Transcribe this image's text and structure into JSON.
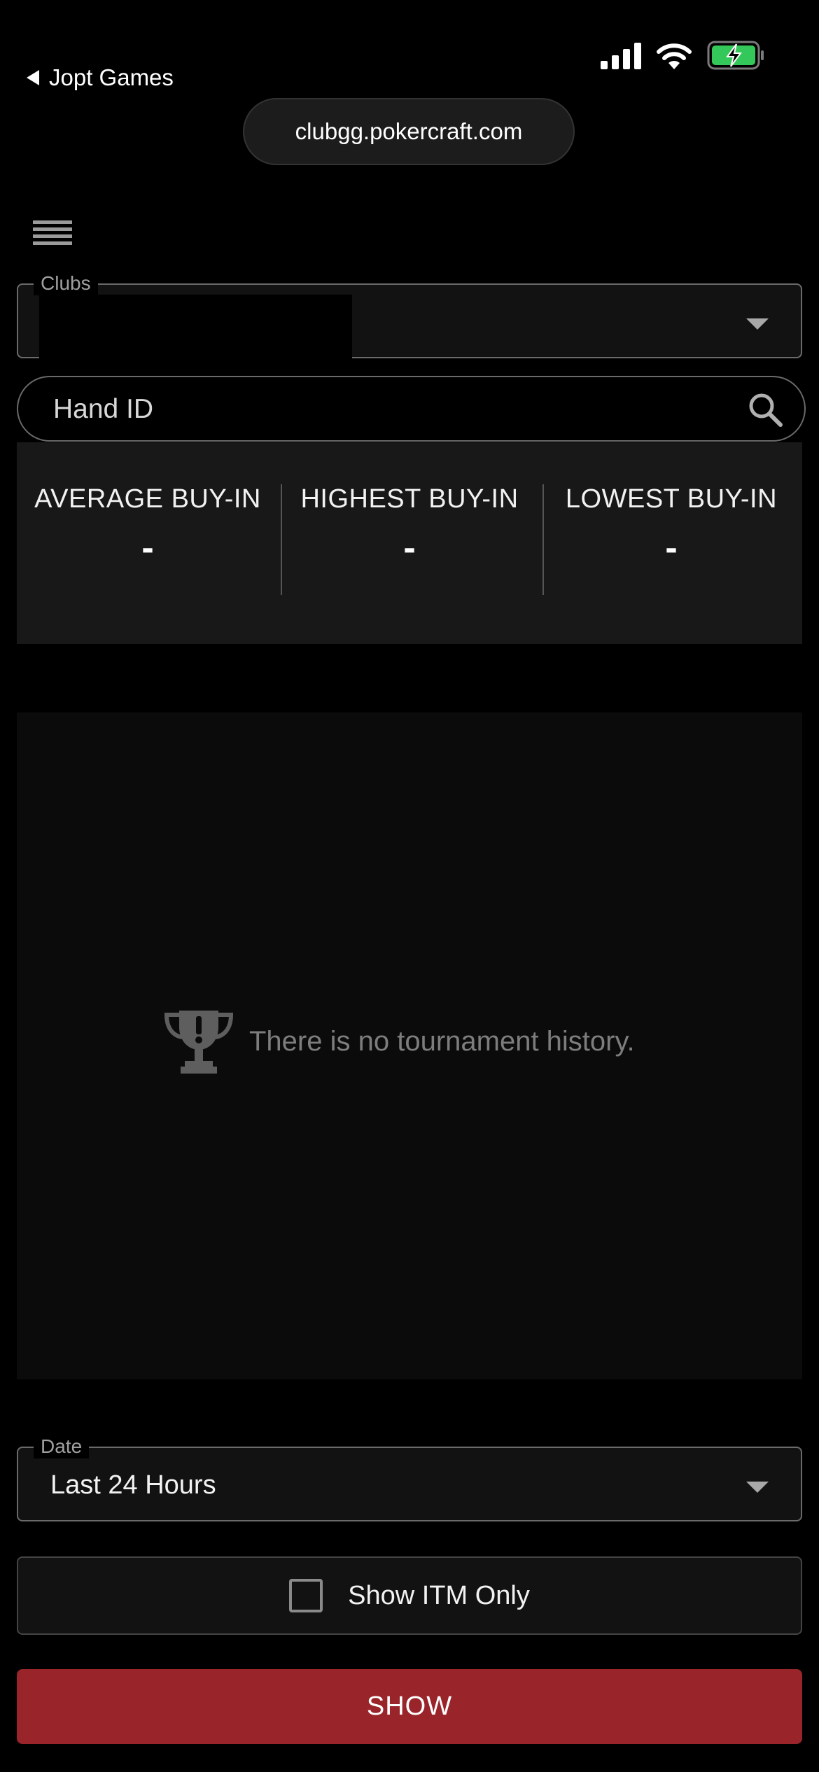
{
  "status_bar": {
    "back_app": "Jopt Games"
  },
  "browser": {
    "url": "clubgg.pokercraft.com"
  },
  "filters": {
    "clubs_label": "Clubs",
    "hand_id_placeholder": "Hand ID"
  },
  "stats": [
    {
      "label": "AVERAGE BUY-IN",
      "value": "-"
    },
    {
      "label": "HIGHEST BUY-IN",
      "value": "-"
    },
    {
      "label": "LOWEST BUY-IN",
      "value": "-"
    }
  ],
  "history": {
    "empty_message": "There is no tournament history."
  },
  "date_filter": {
    "label": "Date",
    "value": "Last 24 Hours"
  },
  "itm": {
    "label": "Show ITM Only",
    "checked": false
  },
  "actions": {
    "show_label": "SHOW"
  },
  "colors": {
    "accent": "#99242a",
    "battery": "#34c759"
  }
}
